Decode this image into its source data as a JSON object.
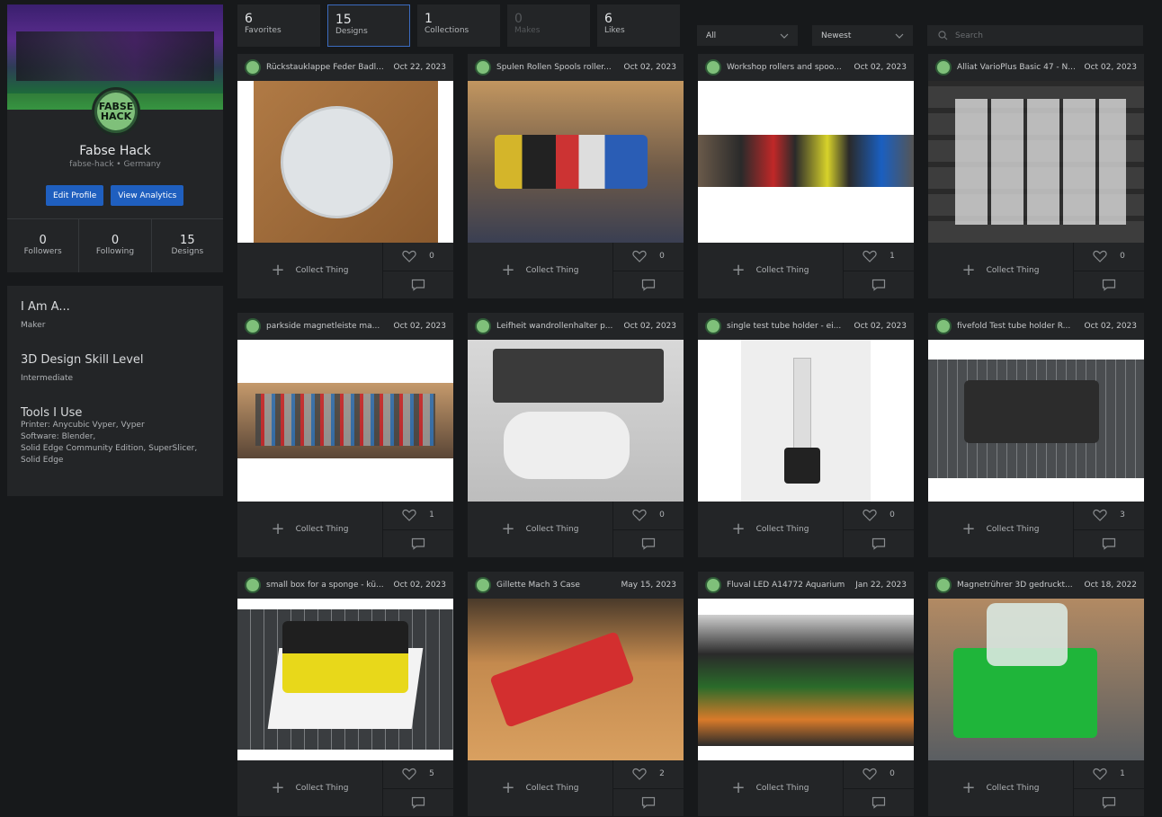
{
  "profile": {
    "name": "Fabse Hack",
    "handle": "fabse-hack • Germany",
    "avatar_text": "FABSE HACK",
    "edit_label": "Edit Profile",
    "analytics_label": "View Analytics",
    "stats": [
      {
        "num": "0",
        "label": "Followers"
      },
      {
        "num": "0",
        "label": "Following"
      },
      {
        "num": "15",
        "label": "Designs"
      }
    ]
  },
  "about": {
    "iam_title": "I Am A...",
    "iam_value": "Maker",
    "skill_title": "3D Design Skill Level",
    "skill_value": "Intermediate",
    "tools_title": "Tools I Use",
    "tools_lines": [
      "Printer: Anycubic Vyper, Vyper",
      "Software: Blender,",
      "Solid Edge Community Edition, SuperSlicer,",
      "Solid Edge"
    ]
  },
  "tabs": [
    {
      "count": "6",
      "label": "Favorites"
    },
    {
      "count": "15",
      "label": "Designs"
    },
    {
      "count": "1",
      "label": "Collections"
    },
    {
      "count": "0",
      "label": "Makes"
    },
    {
      "count": "6",
      "label": "Likes"
    }
  ],
  "filters": {
    "type": "All",
    "sort": "Newest",
    "search_placeholder": "Search"
  },
  "collect_label": "Collect Thing",
  "cards": [
    {
      "title": "Rückstauklappe Feder Badl...",
      "date": "Oct 22, 2023",
      "likes": "0"
    },
    {
      "title": "Spulen Rollen Spools roller...",
      "date": "Oct 02, 2023",
      "likes": "0"
    },
    {
      "title": "Workshop rollers and spoo...",
      "date": "Oct 02, 2023",
      "likes": "1"
    },
    {
      "title": "Alliat VarioPlus Basic 47 - N...",
      "date": "Oct 02, 2023",
      "likes": "0"
    },
    {
      "title": "parkside magnetleiste ma...",
      "date": "Oct 02, 2023",
      "likes": "1"
    },
    {
      "title": "Leifheit wandrollenhalter p...",
      "date": "Oct 02, 2023",
      "likes": "0"
    },
    {
      "title": "single test tube holder - ei...",
      "date": "Oct 02, 2023",
      "likes": "0"
    },
    {
      "title": "fivefold Test tube holder R...",
      "date": "Oct 02, 2023",
      "likes": "3"
    },
    {
      "title": "small box for a sponge - kü...",
      "date": "Oct 02, 2023",
      "likes": "5"
    },
    {
      "title": "Gillette Mach 3 Case",
      "date": "May 15, 2023",
      "likes": "2"
    },
    {
      "title": "Fluval LED A14772 Aquarium",
      "date": "Jan 22, 2023",
      "likes": "0"
    },
    {
      "title": "Magnetrührer 3D gedruckt...",
      "date": "Oct 18, 2022",
      "likes": "1"
    }
  ]
}
